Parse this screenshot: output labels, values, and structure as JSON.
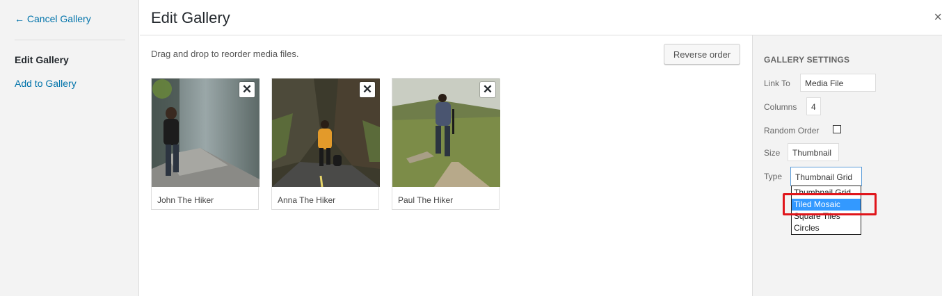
{
  "menu": {
    "cancel_label": "← Cancel Gallery",
    "edit_label": "Edit Gallery",
    "add_label": "Add to Gallery"
  },
  "header": {
    "title": "Edit Gallery",
    "close_icon": "close-icon"
  },
  "content": {
    "hint": "Drag and drop to reorder media files.",
    "reverse_label": "Reverse order",
    "items": [
      {
        "caption": "John The Hiker"
      },
      {
        "caption": "Anna The Hiker"
      },
      {
        "caption": "Paul The Hiker"
      }
    ],
    "remove_glyph": "✕"
  },
  "settings": {
    "heading": "Gallery Settings",
    "link_to_label": "Link To",
    "link_to_value": "Media File",
    "columns_label": "Columns",
    "columns_value": "4",
    "random_order_label": "Random Order",
    "random_order_checked": false,
    "size_label": "Size",
    "size_value": "Thumbnail",
    "type_label": "Type",
    "type_value": "Thumbnail Grid",
    "type_options": [
      "Thumbnail Grid",
      "Tiled Mosaic",
      "Square Tiles",
      "Circles"
    ],
    "type_highlighted": "Tiled Mosaic"
  },
  "colors": {
    "link": "#0073aa",
    "selection": "#3399ff",
    "annotation": "#e0151b"
  }
}
